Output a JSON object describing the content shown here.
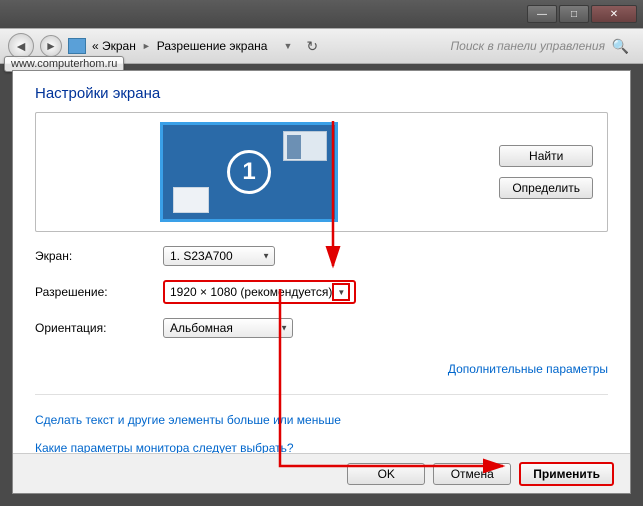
{
  "window": {
    "minimize_glyph": "—",
    "maximize_glyph": "□",
    "close_glyph": "✕"
  },
  "nav": {
    "back_glyph": "◄",
    "forward_glyph": "►",
    "segment1": "« Экран",
    "segment2": "Разрешение экрана",
    "sep": "►",
    "drop": "▼",
    "refresh_glyph": "↻",
    "search_placeholder": "Поиск в панели управления",
    "search_glyph": "🔍"
  },
  "watermark": "www.computerhom.ru",
  "heading": "Настройки экрана",
  "monitor": {
    "number": "1"
  },
  "side_buttons": {
    "find": "Найти",
    "detect": "Определить"
  },
  "fields": {
    "screen_label": "Экран:",
    "screen_value": "1. S23A700",
    "resolution_label": "Разрешение:",
    "resolution_value": "1920 × 1080 (рекомендуется)",
    "orientation_label": "Ориентация:",
    "orientation_value": "Альбомная",
    "combo_arrow": "▼"
  },
  "advanced_link": "Дополнительные параметры",
  "help": {
    "link1": "Сделать текст и другие элементы больше или меньше",
    "link2": "Какие параметры монитора следует выбрать?"
  },
  "footer": {
    "ok": "OK",
    "cancel": "Отмена",
    "apply": "Применить"
  }
}
